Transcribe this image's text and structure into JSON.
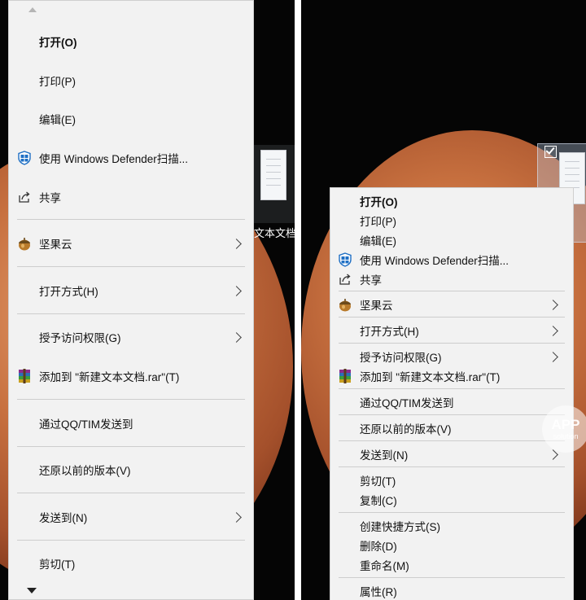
{
  "file": {
    "name_left": "文本文档",
    "name_right": ""
  },
  "left_menu": {
    "items": [
      {
        "label": "打开(O)",
        "bold": true
      },
      {
        "label": "打印(P)"
      },
      {
        "label": "编辑(E)"
      },
      {
        "label": "使用 Windows Defender扫描...",
        "icon": "windows-defender-shield-icon"
      },
      {
        "label": "共享",
        "icon": "share-icon"
      },
      {
        "label": "坚果云",
        "icon": "nutstore-acorn-icon",
        "submenu": true
      },
      {
        "label": "打开方式(H)",
        "submenu": true
      },
      {
        "label": "授予访问权限(G)",
        "submenu": true
      },
      {
        "label": "添加到 \"新建文本文档.rar\"(T)",
        "icon": "winrar-icon"
      },
      {
        "label": "通过QQ/TIM发送到"
      },
      {
        "label": "还原以前的版本(V)"
      },
      {
        "label": "发送到(N)",
        "submenu": true
      },
      {
        "label": "剪切(T)"
      }
    ]
  },
  "right_menu": {
    "items": [
      {
        "label": "打开(O)",
        "bold": true
      },
      {
        "label": "打印(P)"
      },
      {
        "label": "编辑(E)"
      },
      {
        "label": "使用 Windows Defender扫描...",
        "icon": "windows-defender-shield-icon"
      },
      {
        "label": "共享",
        "icon": "share-icon"
      },
      {
        "label": "坚果云",
        "icon": "nutstore-acorn-icon",
        "submenu": true
      },
      {
        "label": "打开方式(H)",
        "submenu": true
      },
      {
        "label": "授予访问权限(G)",
        "submenu": true
      },
      {
        "label": "添加到 \"新建文本文档.rar\"(T)",
        "icon": "winrar-icon"
      },
      {
        "label": "通过QQ/TIM发送到"
      },
      {
        "label": "还原以前的版本(V)"
      },
      {
        "label": "发送到(N)",
        "submenu": true
      },
      {
        "label": "剪切(T)"
      },
      {
        "label": "复制(C)"
      },
      {
        "label": "创建快捷方式(S)"
      },
      {
        "label": "删除(D)"
      },
      {
        "label": "重命名(M)"
      },
      {
        "label": "属性(R)"
      }
    ]
  },
  "watermark": {
    "text": "APP",
    "sub": "solution"
  },
  "colors": {
    "menu_bg": "#f2f2f2",
    "separator": "#cdcdcd",
    "desktop_bg": "#050505",
    "mars": "#c7703f"
  }
}
